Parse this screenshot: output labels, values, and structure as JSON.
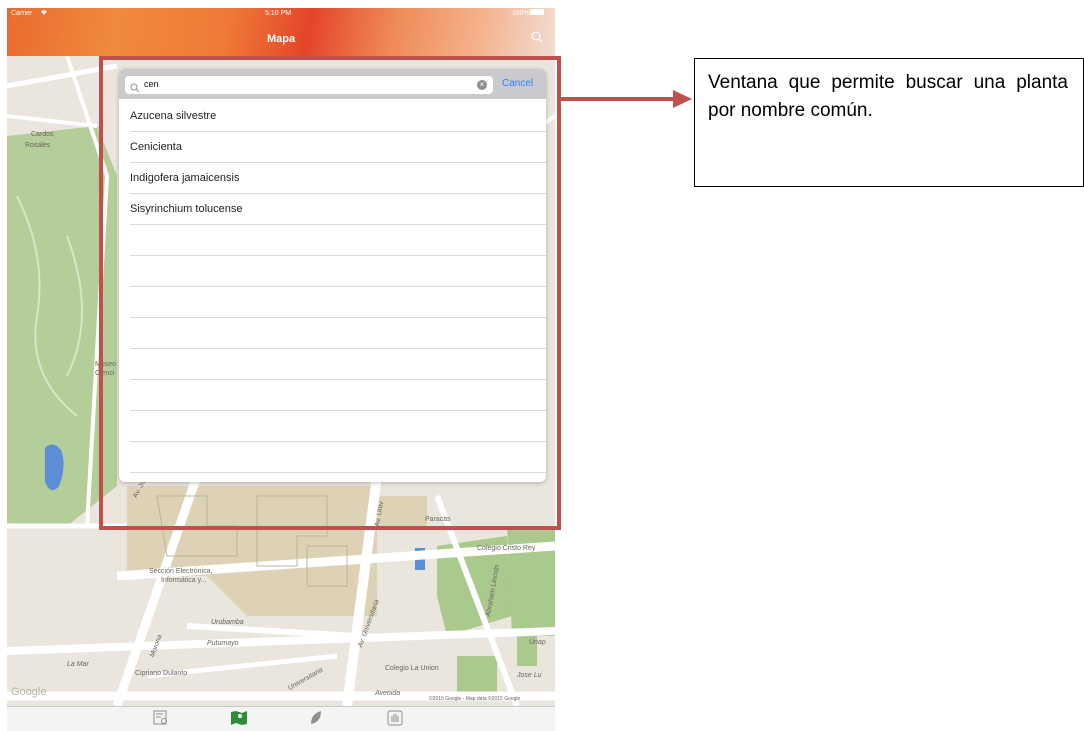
{
  "status_bar": {
    "carrier": "Carrier",
    "time": "5:10 PM",
    "battery": "100%"
  },
  "nav": {
    "title": "Mapa",
    "search_icon": "search-icon"
  },
  "search": {
    "query": "cen",
    "cancel_label": "Cancel",
    "results": [
      "Azucena silvestre",
      "Cenicienta",
      "Indigofera jamaicensis",
      "Sisyrinchium tolucense"
    ]
  },
  "map_labels": {
    "cardos": "Cardos",
    "rosales": "Rosales",
    "museo": "Museo",
    "cienci": "Cienci",
    "av_jose_riva": "Av. José de la Riva",
    "av_univ_top": "Av. Univ",
    "paracas": "Paracas",
    "colegio_cristo_rey": "Colegio Cristo Rey",
    "seccion": "Sección Electrónica,",
    "informatica": "Informática y...",
    "av_universitaria": "Av. Universitaria",
    "abraham_lincoln": "Abraham Lincoln",
    "urubamba": "Urubamba",
    "morona": "Morona",
    "putumayo": "Putumayo",
    "unap": "Unap",
    "la_mar": "La Mar",
    "cipriano_dulanto": "Cipriano Dulanto",
    "universitaria_bottom": "Universitaria",
    "colegio_la_union": "Colegio La Union",
    "jose_lu": "Jose Lu",
    "avenida": "Avenida",
    "google": "Google",
    "attribution": "©2015 Google - Map data ©2015 Google"
  },
  "tab_bar": {
    "icons": [
      "catalog-icon",
      "map-icon",
      "leaf-icon",
      "hand-icon"
    ]
  },
  "callout": {
    "text": "Ventana que permite buscar una planta por nombre común."
  },
  "colors": {
    "highlight": "#c0504d",
    "cancel": "#2b83f4",
    "park": "#a9c98d",
    "map_bg": "#eae6de"
  }
}
